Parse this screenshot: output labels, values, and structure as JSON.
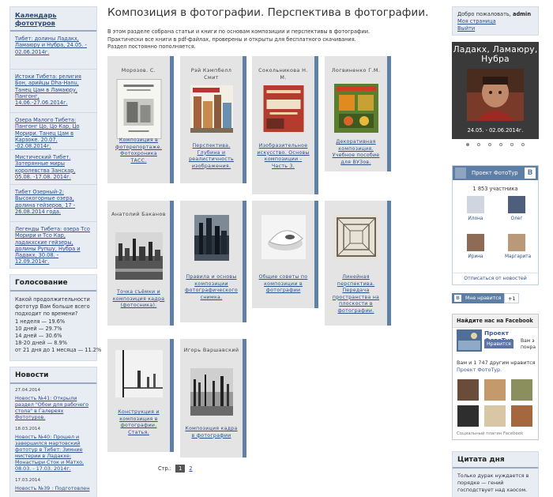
{
  "left": {
    "calendar_title": "Календарь фототуров",
    "tours": [
      "Тибет: долины Ладакх, Ламаюру и Нубра, 24.05. - 02.06.2014г.",
      "Истоки Тибета: религия Бон, арийцы Dha-Hanu, Танец Цам в Ламаюру, Пангонг, 14.06.-27.06.2014г.",
      "Озера Малого Тибета: Пангонг Цо, Цо Кар, Цо Морири. Танец Цам в Карзоке. 20.07. -02.08.2014г.",
      "Мистический Тибет. Затерянные миры королевства Занскар, 05.08. -17.08. 2014г.",
      "Тибет Озерный-2: Высокогорные озера, долина гейзеров, 17 - 26.08.2014 года.",
      "Легенды Тибета: озера Тсо Морири и Тсо Кар, ладакхские гейзеры, долины Рупшу, Нубра и Ладакх, 30.08. - 12.09.2014г."
    ],
    "poll_title": "Голосование",
    "poll_question": "Какой продолжительности фототур Вам больше всего подходит по времени?",
    "poll_results": [
      "1 неделя — 19.6%",
      "10 дней — 29.7%",
      "14 дней — 30.6%",
      "18-20 дней — 8.9%",
      "от 21 дня до 1 месяца — 11.2%"
    ],
    "news_title": "Новости",
    "news": [
      {
        "date": "27.04.2014",
        "text": "Новость №41: Открыли раздел \"Обои для рабочего стола\" в Галереях Фототуров."
      },
      {
        "date": "18.03.2014",
        "text": "Новость №40: Прошел и завершился мартовский фототур в Тибет: Зимние мистерии в Ладакхе: Монастыри Сток и Матхо, 08.03. - 17.03. 2014г."
      },
      {
        "date": "17.03.2014",
        "text": "Новость №39 : Подготовлен"
      }
    ]
  },
  "main": {
    "title": "Композиция в фотографии. Перспектива в фотографии.",
    "intro": [
      "В этом разделе собрана статьи и книги по основам композиции и перспективы в фотографии.",
      "Практически все книги в pdf-файлах, проверены и открыты для бесплатного скачивания.",
      "Раздел постоянно пополняется."
    ],
    "books": [
      {
        "author": "Морозов. С.",
        "title": "Композиция в фоторепортаже. Фотохроника ТАСС."
      },
      {
        "author": "Рэй Кэмпбелл Смит",
        "title": "Перспектива. Глубина и реалистичность изображения."
      },
      {
        "author": "Сокольникова Н. М.",
        "title": "Изобразительное искусство. Основы композиции - Часть 3."
      },
      {
        "author": "Логвиненко Г.М.",
        "title": "Декоративная композиция. Учебное пособие для ВУЗов."
      },
      {
        "author": "Анатолий Баканов",
        "title": "Точка съёмки и композиция кадра (фотосника)."
      },
      {
        "author": "",
        "title": "Правила и основы композиции фотографического снимка."
      },
      {
        "author": "",
        "title": "Общие советы по композиции в фотографии"
      },
      {
        "author": "",
        "title": "Линейная перспектива. Передача пространства на плоскости в фотографии."
      },
      {
        "author": "",
        "title": "Конструкция и композиция в фотографии. Статья."
      },
      {
        "author": "Игорь Варшавский",
        "title": "Композиция кадра в фотографии"
      }
    ],
    "pager_label": "Стр.:",
    "pager_current": "1",
    "pager_next": "2"
  },
  "right": {
    "welcome": "Добро пожаловать,",
    "user": "admin",
    "my_page": "Моя страница",
    "logout": "Выйти",
    "slide_title": "Ладакх, Ламаюру, Нубра",
    "slide_date": "24.05. - 02.06.2014г.",
    "vk_group": "Проект ФотоТур",
    "vk_logo": "В",
    "vk_members": "1 853 участника",
    "vk_people": [
      "Илона",
      "Олег",
      "Ирина",
      "Маргарита"
    ],
    "vk_unsub": "Отписаться от новостей",
    "like_label": "Мне нравится",
    "like_count": "+1",
    "fb_title": "Найдите нас на Facebook",
    "fb_page": "Проект ФотоТур",
    "fb_like": "Нравится",
    "fb_you": "Вам э понра",
    "fb_text": "Вам и 1 747 другим нравится",
    "fb_page_link": "Проект ФотоТур.",
    "fb_foot": "Социальный плагин Facebook",
    "quote_title": "Цитата дня",
    "quote_text": "Только дурак нуждается в порядке — гений господствует над хаосом."
  }
}
